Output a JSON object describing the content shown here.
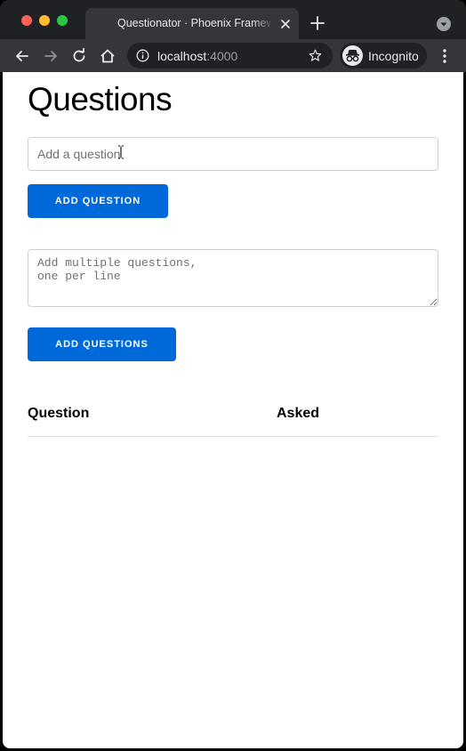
{
  "browser": {
    "tab": {
      "title": "Questionator · Phoenix Framework"
    },
    "toolbar": {
      "url_host": "localhost",
      "url_port": ":4000",
      "incognito_label": "Incognito"
    },
    "colors": {
      "tab_bar": "#202124",
      "toolbar": "#35363a"
    }
  },
  "page": {
    "title": "Questions",
    "question_input": {
      "placeholder": "Add a question",
      "value": ""
    },
    "add_question_button": "Add Question",
    "questions_textarea": {
      "placeholder": "Add multiple questions,\none per line",
      "value": ""
    },
    "add_questions_button": "Add Questions",
    "table": {
      "columns": [
        "Question",
        "Asked"
      ],
      "rows": []
    },
    "colors": {
      "button": "#0069d9",
      "background": "#ffffff"
    }
  },
  "icons": {
    "close": "close-icon",
    "new_tab": "plus-icon",
    "tab_search": "chevron-down-icon",
    "back": "back-arrow-icon",
    "forward": "forward-arrow-icon",
    "reload": "reload-icon",
    "home": "home-icon",
    "site_info": "info-icon",
    "bookmark": "star-icon",
    "incognito": "incognito-icon",
    "menu": "kebab-menu-icon",
    "text_cursor": "ibeam-cursor-icon"
  }
}
